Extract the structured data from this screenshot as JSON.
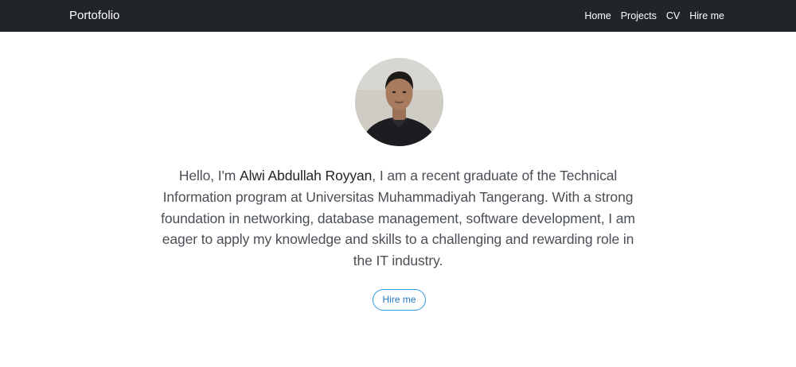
{
  "navbar": {
    "brand": "Portofolio",
    "links": [
      "Home",
      "Projects",
      "CV",
      "Hire me"
    ]
  },
  "hero": {
    "intro_prefix": "Hello, I'm ",
    "name": "Alwi Abdullah Royyan",
    "intro_suffix": ", I am a recent graduate of the Technical Information program at Universitas Muhammadiyah Tangerang. With a strong foundation in networking, database management, software development, I am eager to apply my knowledge and skills to a challenging and rewarding role in the IT industry.",
    "button_label": "Hire me"
  },
  "colors": {
    "navbar_bg": "#212529",
    "text": "#4a4f55",
    "accent": "#2e9be6"
  }
}
